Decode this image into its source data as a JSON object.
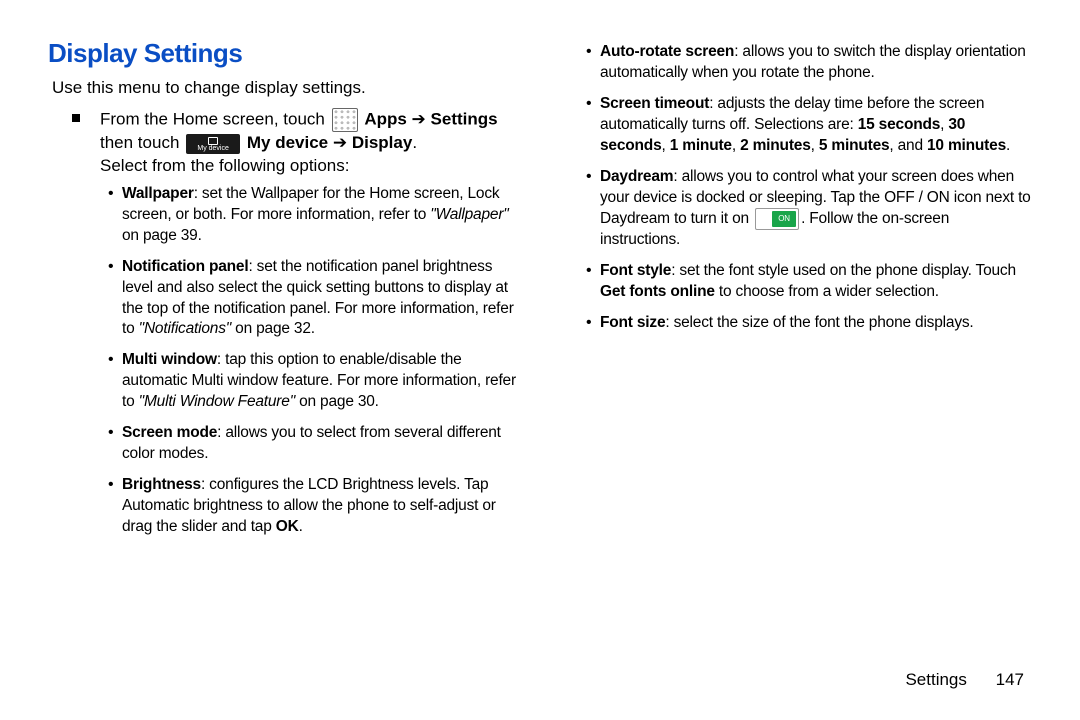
{
  "title": "Display Settings",
  "intro": "Use this menu to change display settings.",
  "nav": {
    "line1_pre": "From the Home screen, touch ",
    "apps_label": "Apps",
    "arrow": " ➔ ",
    "settings_label": "Settings",
    "line2_pre": "then touch ",
    "mydevice_icon_text": "My device",
    "mydevice_label": "My device",
    "display_label": "Display",
    "line3": "Select from the following options:"
  },
  "left_items": [
    {
      "term": "Wallpaper",
      "body1": ": set the Wallpaper for the Home screen, Lock screen, or both. For more information, refer to ",
      "ref": "\"Wallpaper\"",
      "body2": " on page 39."
    },
    {
      "term": "Notification panel",
      "body1": ": set the notification panel brightness level and also select the quick setting buttons to display at the top of the notification panel. For more information, refer to ",
      "ref": "\"Notifications\"",
      "body2": "  on page 32."
    },
    {
      "term": "Multi window",
      "body1": ": tap this option to enable/disable the automatic Multi window feature. For more information, refer to ",
      "ref": "\"Multi Window Feature\"",
      "body2": "  on page 30."
    },
    {
      "term": "Screen mode",
      "body1": ": allows you to select from several different color modes."
    },
    {
      "term": "Brightness",
      "body1": ": configures the LCD Brightness levels. Tap Automatic brightness to allow the phone to self-adjust or drag the slider and tap ",
      "bold_tail": "OK",
      "body2": "."
    }
  ],
  "right_items": [
    {
      "term": "Auto-rotate screen",
      "body1": ": allows you to switch the display orientation automatically when you rotate the phone."
    },
    {
      "term": "Screen timeout",
      "body1": ": adjusts the delay time before the screen automatically turns off. Selections are: ",
      "opts": [
        "15 seconds",
        "30 seconds",
        "1 minute",
        "2 minutes",
        "5 minutes"
      ],
      "join_last": ", and ",
      "opt_last": "10 minutes",
      "tail": "."
    },
    {
      "term": "Daydream",
      "body1": ": allows you to control what your screen does when your device is docked or sleeping. Tap the OFF / ON icon next to Daydream to turn it on ",
      "body2": ". Follow the on-screen instructions."
    },
    {
      "term": "Font style",
      "body1": ": set the font style used on the phone display. Touch ",
      "bold_tail": "Get fonts online",
      "body2": " to choose from a wider selection."
    },
    {
      "term": "Font size",
      "body1": ": select the size of the font the phone displays."
    }
  ],
  "footer": {
    "section": "Settings",
    "page": "147"
  }
}
